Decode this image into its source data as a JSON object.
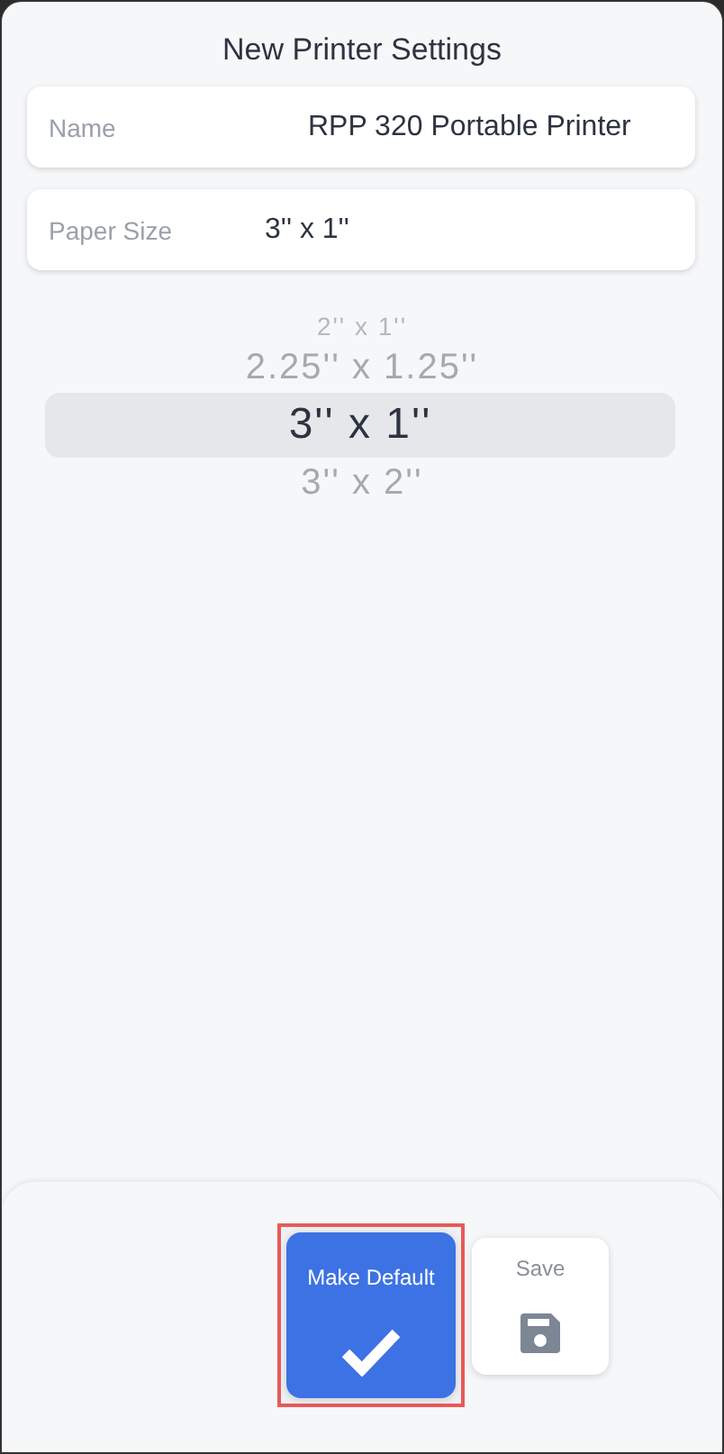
{
  "title": "New Printer Settings",
  "fields": [
    {
      "label": "Name",
      "value": "RPP 320 Portable Printer"
    },
    {
      "label": "Paper Size",
      "value": "3'' x 1''"
    }
  ],
  "picker": [
    {
      "label": "2'' x 1''",
      "selected": false
    },
    {
      "label": "2.25'' x 1.25''",
      "selected": false
    },
    {
      "label": "3'' x 1''",
      "selected": true
    },
    {
      "label": "3'' x 2''",
      "selected": false
    }
  ],
  "actions": [
    {
      "label": "Make Default",
      "kind": "primary",
      "highlighted": true
    },
    {
      "label": "Save",
      "kind": "secondary",
      "highlighted": false
    }
  ]
}
